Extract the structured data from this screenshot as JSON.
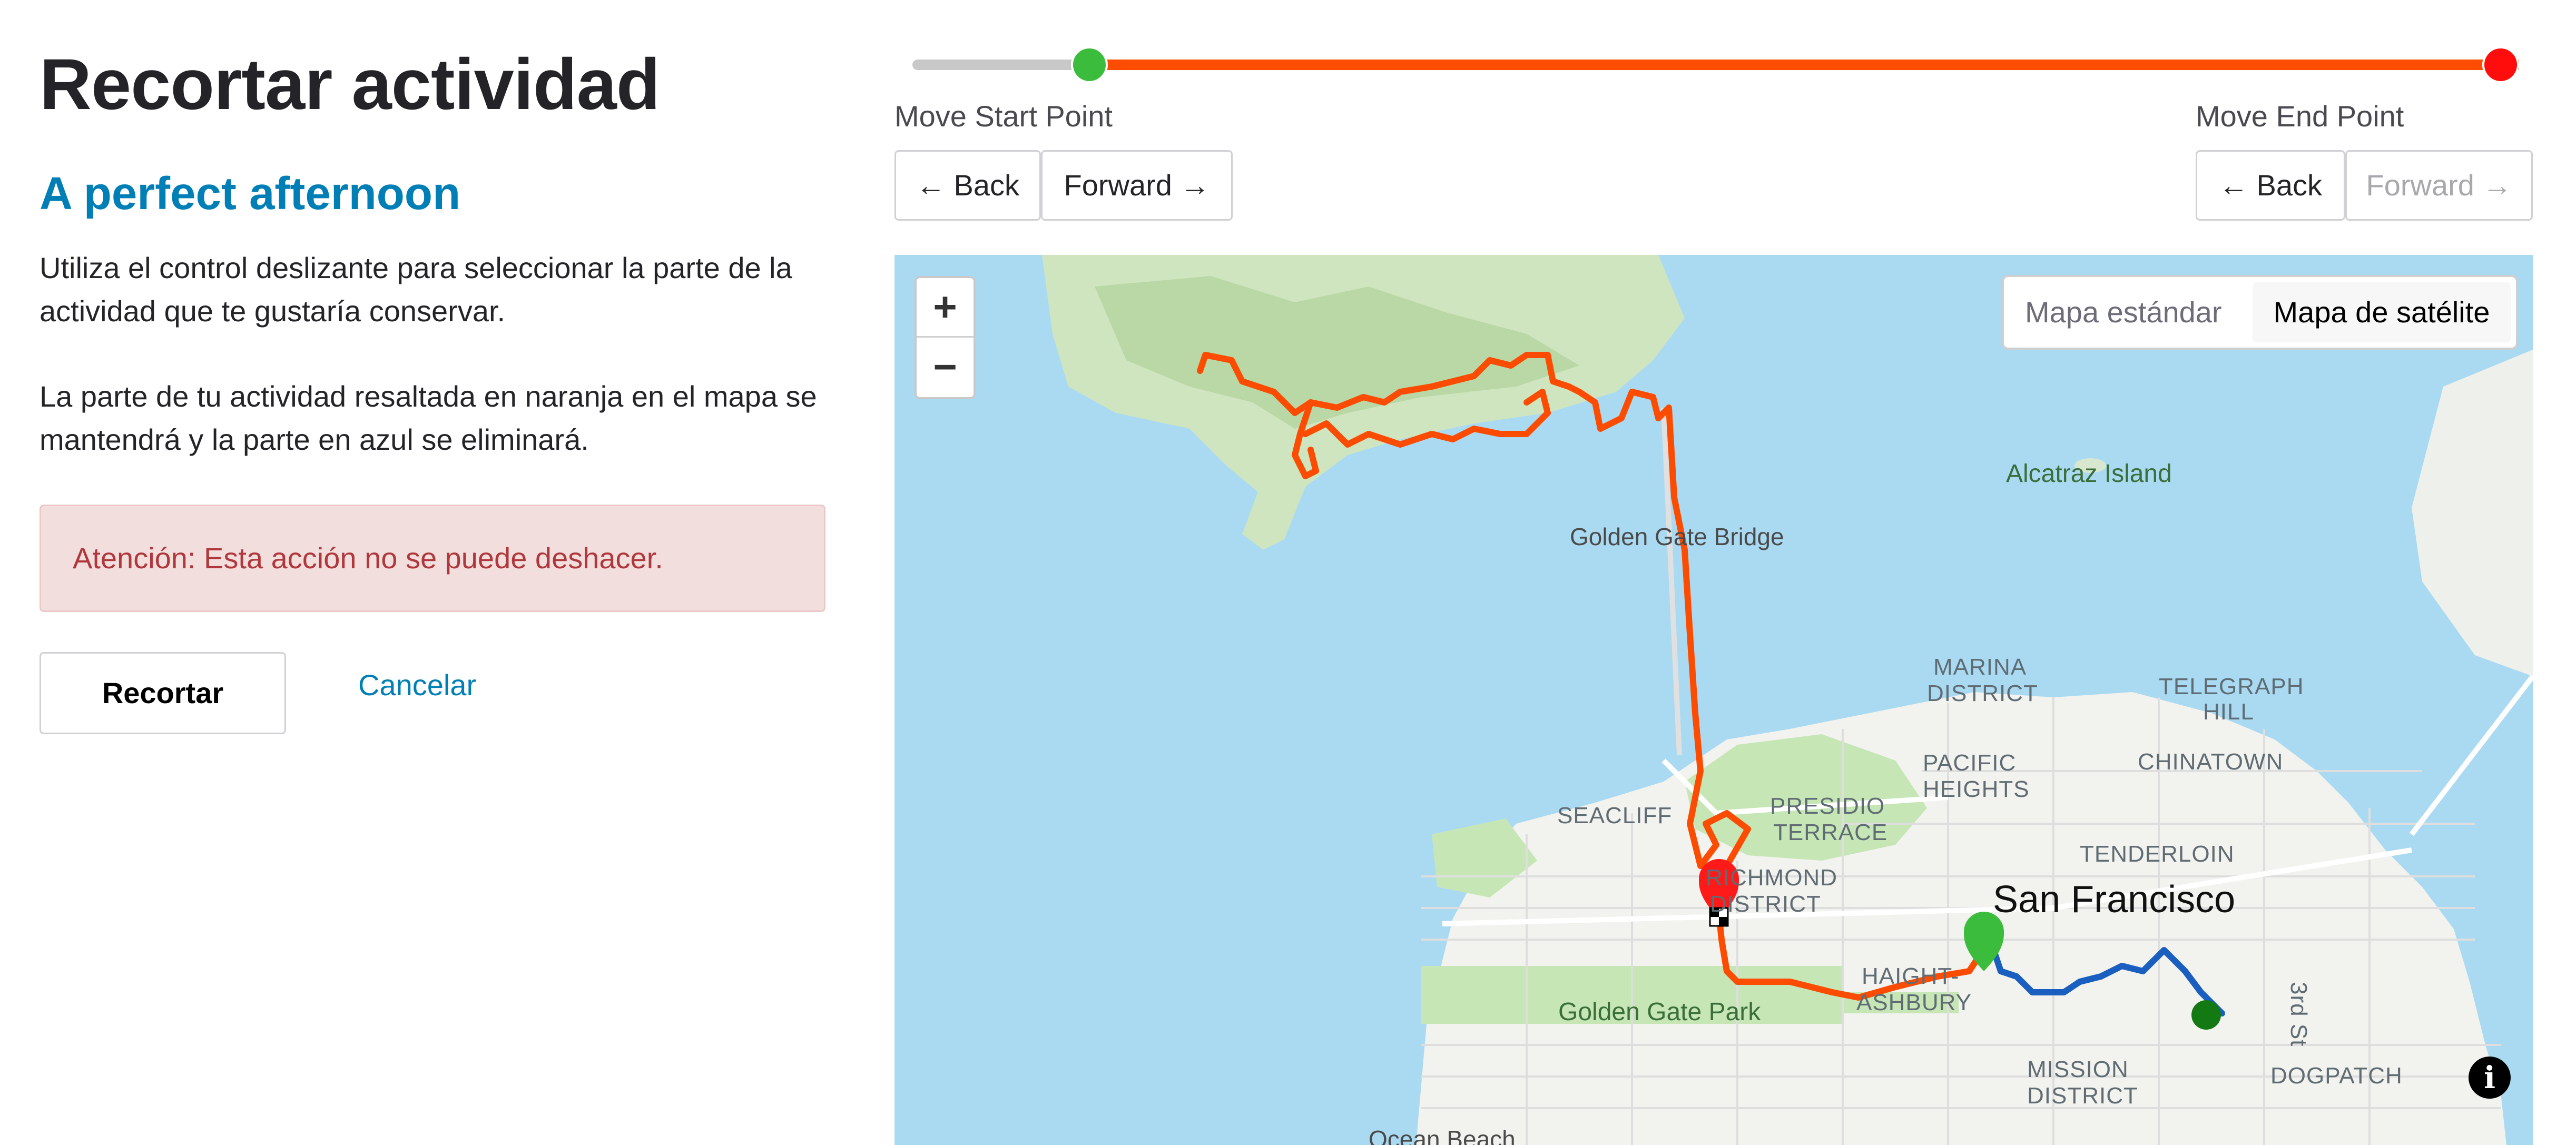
{
  "page": {
    "title": "Recortar actividad",
    "activity_name": "A perfect afternoon",
    "instructions_1": "Utiliza el control deslizante para seleccionar la parte de la actividad que te gustaría conservar.",
    "instructions_2": "La parte de tu actividad resaltada en naranja en el mapa se mantendrá y la parte en azul se eliminará.",
    "warning": "Atención: Esta acción no se puede deshacer.",
    "crop_button": "Recortar",
    "cancel_link": "Cancelar"
  },
  "controls": {
    "start_label": "Move Start Point",
    "end_label": "Move End Point",
    "back_label": "← Back",
    "forward_label": "Forward →",
    "slider_start_fraction": 0.11,
    "slider_end_fraction": 1.0,
    "end_forward_disabled": true
  },
  "map": {
    "zoom_in": "+",
    "zoom_out": "−",
    "standard_label": "Mapa estándar",
    "satellite_label": "Mapa de satélite",
    "info_icon": "i",
    "labels": {
      "alcatraz": "Alcatraz Island",
      "golden_gate_bridge": "Golden Gate Bridge",
      "marina_1": "MARINA",
      "marina_2": "DISTRICT",
      "telegraph_1": "TELEGRAPH",
      "telegraph_2": "HILL",
      "pacific_1": "PACIFIC",
      "pacific_2": "HEIGHTS",
      "chinatown": "CHINATOWN",
      "seacliff": "SEACLIFF",
      "presidio_1": "PRESIDIO",
      "presidio_2": "TERRACE",
      "tenderloin": "TENDERLOIN",
      "richmond_1": "RICHMOND",
      "richmond_2": "DISTRICT",
      "san_francisco": "San Francisco",
      "haight_1": "HAIGHT-",
      "haight_2": "ASHBURY",
      "golden_gate_park": "Golden Gate Park",
      "third_st": "3rd St",
      "mission_1": "MISSION",
      "mission_2": "DISTRICT",
      "dogpatch": "DOGPATCH",
      "ocean_beach": "Ocean Beach"
    },
    "colors": {
      "kept_route": "#fc4c02",
      "removed_route": "#1a5fbf",
      "water": "#aadaf2",
      "land": "#f2f2ee",
      "park": "#c6e6b6"
    }
  }
}
